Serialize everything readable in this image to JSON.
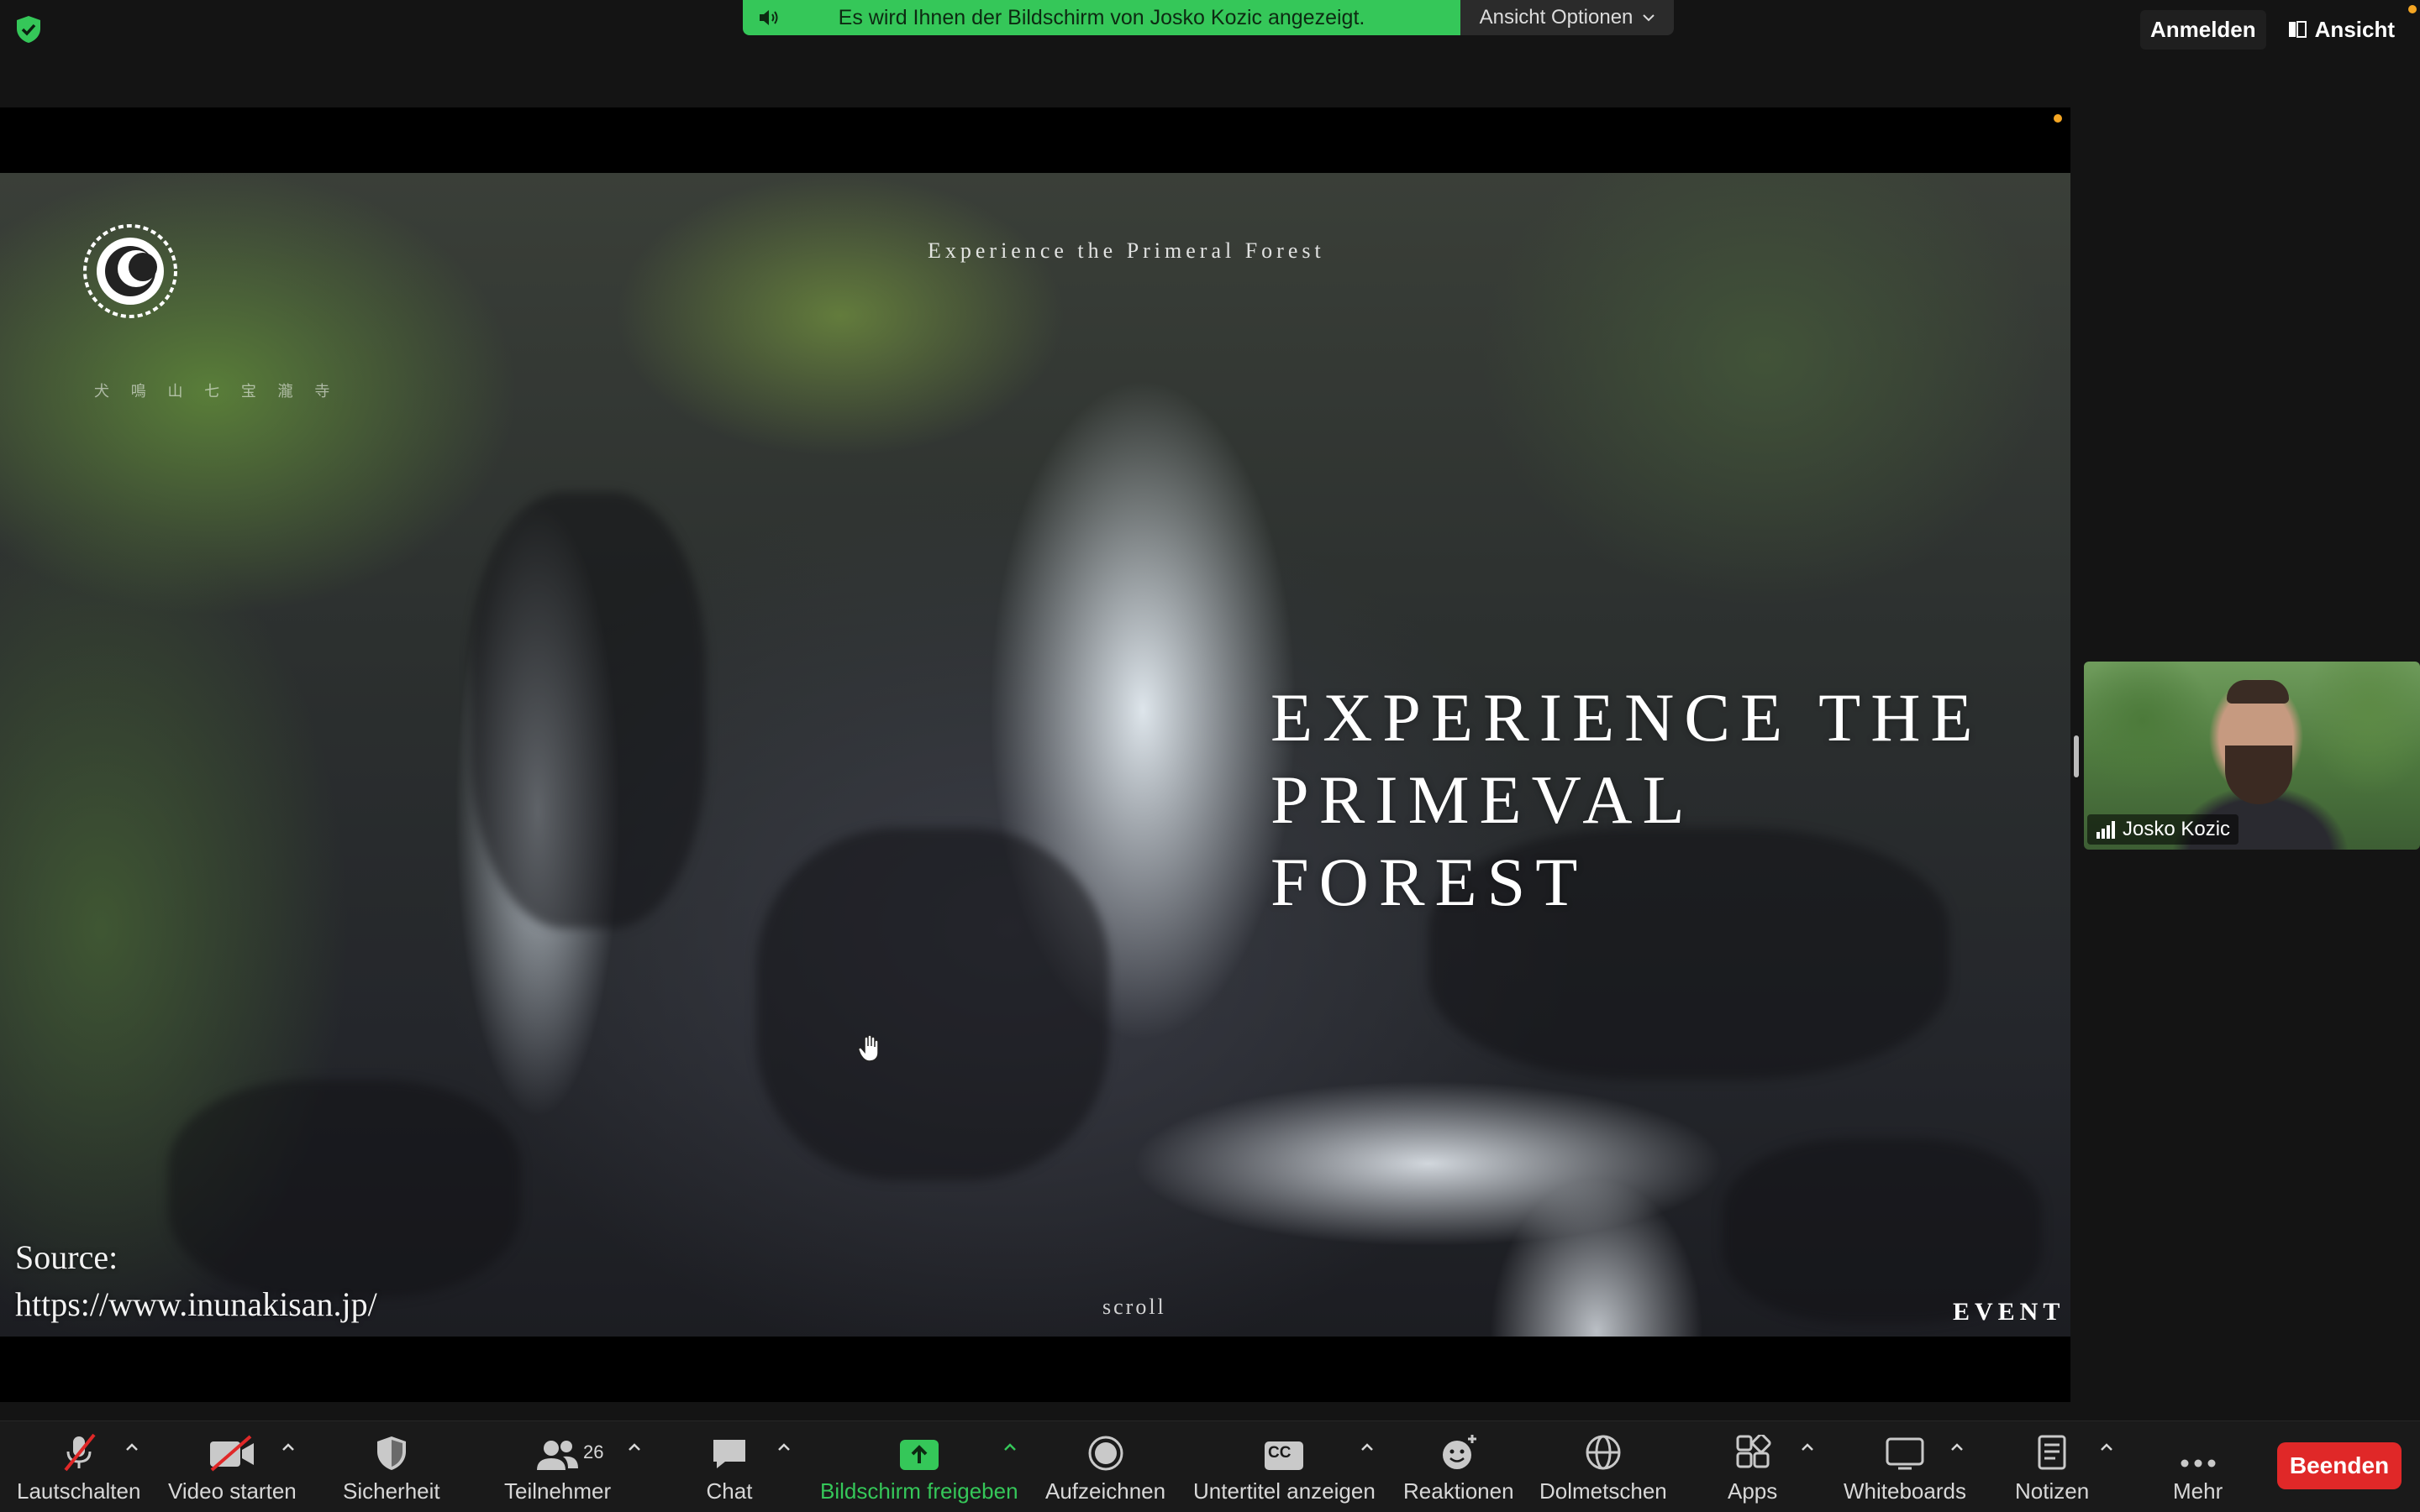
{
  "share_banner": {
    "text": "Es wird Ihnen der Bildschirm von Josko Kozic angezeigt."
  },
  "view_options": {
    "label": "Ansicht Optionen"
  },
  "top_right": {
    "signin": "Anmelden",
    "view": "Ansicht"
  },
  "shared_content": {
    "tagline": "Experience the Primeral Forest",
    "headline_line1": "EXPERIENCE THE",
    "headline_line2": "PRIMEVAL FOREST",
    "jp_subtitle": "犬 鳴 山 七 宝 瀧 寺",
    "source_label": "Source:",
    "source_url": "https://www.inunakisan.jp/",
    "scroll": "scroll",
    "event": "EVENT"
  },
  "participant": {
    "name": "Josko Kozic"
  },
  "toolbar": {
    "mute": "Lautschalten",
    "video": "Video starten",
    "security": "Sicherheit",
    "participants": "Teilnehmer",
    "participants_count": "26",
    "chat": "Chat",
    "share": "Bildschirm freigeben",
    "record": "Aufzeichnen",
    "captions": "Untertitel anzeigen",
    "captions_badge": "CC",
    "reactions": "Reaktionen",
    "interpret": "Dolmetschen",
    "apps": "Apps",
    "whiteboards": "Whiteboards",
    "notes": "Notizen",
    "more": "Mehr",
    "end": "Beenden"
  },
  "colors": {
    "share_green": "#35c759",
    "end_red": "#e02828",
    "toolbar_bg": "#1a1a1a"
  }
}
